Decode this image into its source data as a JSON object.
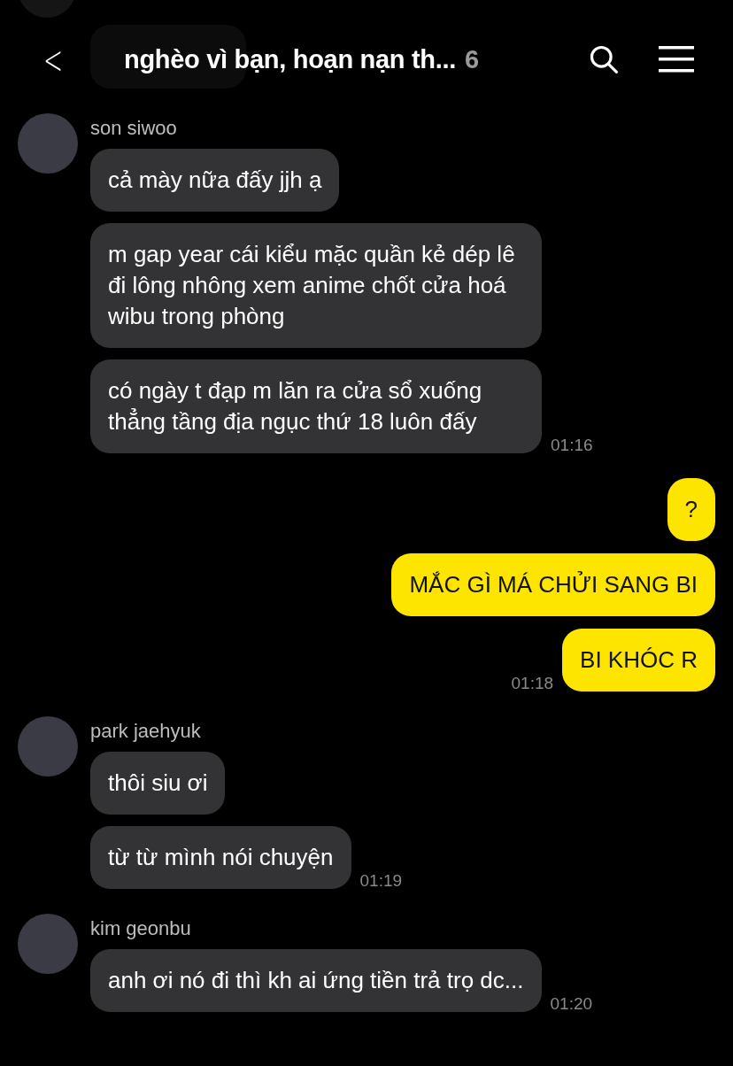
{
  "header": {
    "back": "<",
    "title": "nghèo vì bạn, hoạn nạn th...",
    "member_count": "6"
  },
  "messages": [
    {
      "kind": "incoming",
      "sender": "son siwoo",
      "bubbles": [
        "cả mày nữa đấy jjh ạ",
        "m gap year cái kiểu mặc quần kẻ dép lê đi lông nhông xem anime chốt cửa hoá wibu trong phòng",
        "có ngày t đạp m lăn ra cửa sổ xuống thẳng tầng địa ngục thứ 18 luôn đấy"
      ],
      "time": "01:16"
    },
    {
      "kind": "outgoing",
      "bubbles": [
        "?",
        "MẮC GÌ MÁ CHỬI SANG BI",
        "BI KHÓC R"
      ],
      "time": "01:18"
    },
    {
      "kind": "incoming",
      "sender": "park jaehyuk",
      "bubbles": [
        "thôi siu ơi",
        "từ từ mình nói chuyện"
      ],
      "time": "01:19"
    },
    {
      "kind": "incoming",
      "sender": "kim geonbu",
      "bubbles": [
        "anh ơi nó đi thì kh ai ứng tiền trả trọ dc..."
      ],
      "time": "01:20"
    }
  ]
}
